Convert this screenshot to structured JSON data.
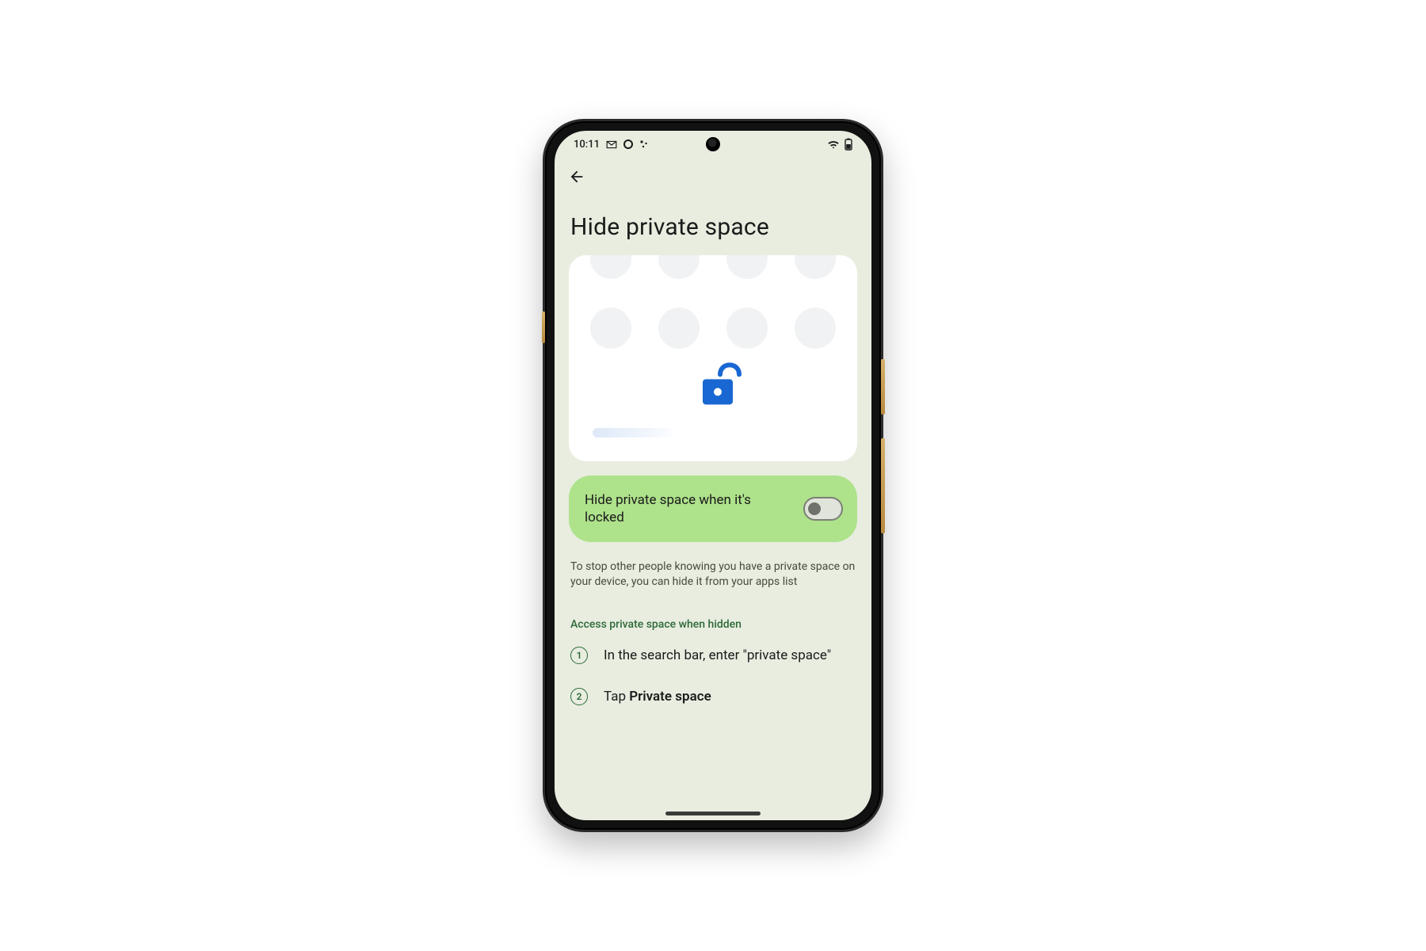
{
  "status": {
    "time": "10:11",
    "icons_left": [
      "gmail-icon",
      "circle-icon",
      "more-icon"
    ],
    "icons_right": [
      "wifi-icon",
      "battery-icon"
    ]
  },
  "page": {
    "title": "Hide private space",
    "toggle_label": "Hide private space when it's locked",
    "toggle_on": false,
    "body_text": "To stop other people knowing you have a private space on your device, you can hide it from your apps list",
    "section_head": "Access private space when hidden",
    "steps": [
      {
        "text": "In the search bar, enter \"private space\""
      },
      {
        "prefix": "Tap ",
        "bold": "Private space"
      }
    ]
  }
}
